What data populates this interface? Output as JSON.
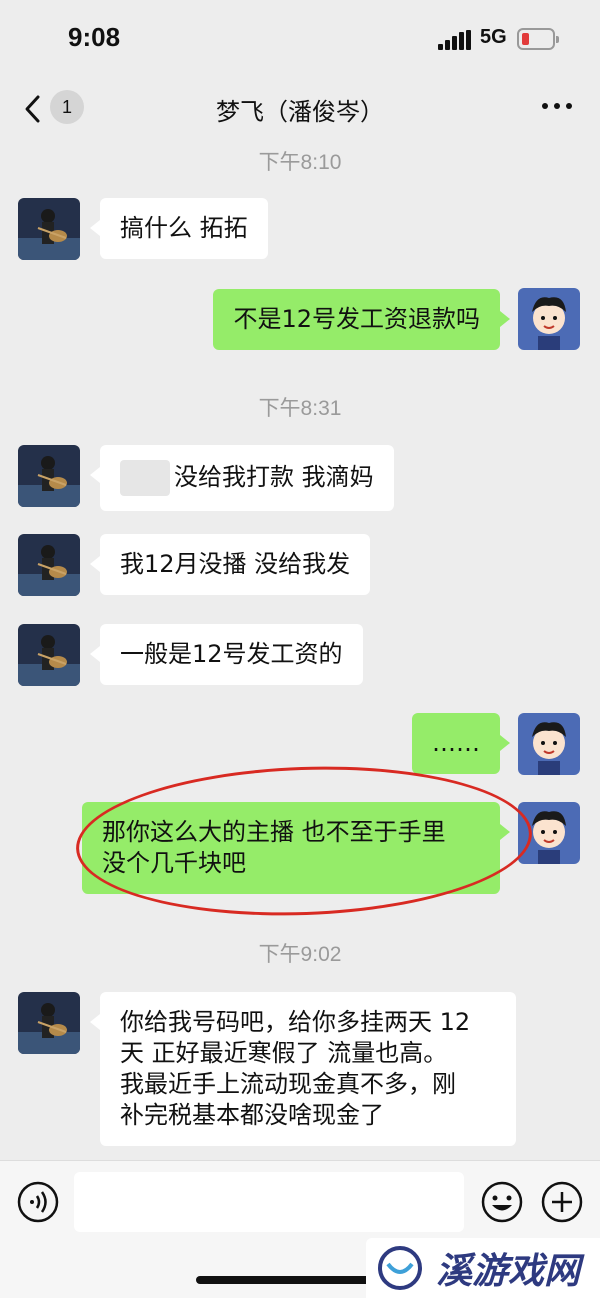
{
  "status": {
    "time": "9:08",
    "network": "5G"
  },
  "header": {
    "back_count": "1",
    "title": "梦飞（潘俊岑）"
  },
  "timestamps": [
    "下午8:10",
    "下午8:31",
    "下午9:02"
  ],
  "messages": [
    {
      "side": "in",
      "text": "搞什么 拓拓"
    },
    {
      "side": "out",
      "text": "不是12号发工资退款吗"
    },
    {
      "side": "in",
      "text": "没给我打款 我滴妈"
    },
    {
      "side": "in",
      "text": "我12月没播 没给我发"
    },
    {
      "side": "in",
      "text": "一般是12号发工资的"
    },
    {
      "side": "out",
      "text": "……"
    },
    {
      "side": "out",
      "lines": [
        "那你这么大的主播 也不至于手里",
        "没个几千块吧"
      ]
    },
    {
      "side": "in",
      "lines": [
        "你给我号码吧，给你多挂两天 12",
        "天 正好最近寒假了 流量也高。",
        "我最近手上流动现金真不多，刚",
        "补完税基本都没啥现金了"
      ]
    }
  ],
  "watermark": {
    "brand": "溪游戏网"
  },
  "colors": {
    "incoming_bubble": "#ffffff",
    "outgoing_bubble": "#95ec69",
    "highlight_circle": "#d82a22"
  },
  "icons": [
    "back-chevron-icon",
    "more-dots-icon",
    "voice-icon",
    "emoji-icon",
    "plus-icon"
  ]
}
